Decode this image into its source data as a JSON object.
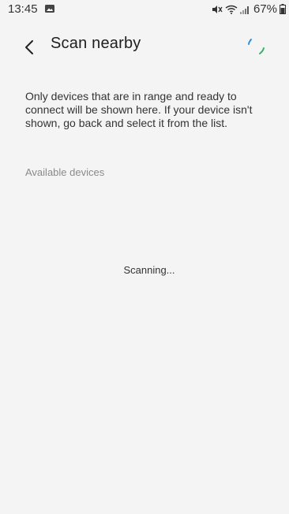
{
  "status_bar": {
    "time": "13:45",
    "battery": "67%",
    "icons": [
      "gallery-icon",
      "mute-icon",
      "wifi-icon",
      "signal-icon",
      "battery-icon"
    ]
  },
  "header": {
    "title": "Scan nearby",
    "back_icon": "chevron-left-icon",
    "spinner_icon": "loading-spinner-icon"
  },
  "main": {
    "description": "Only devices that are in range and ready to connect will be shown here. If your device isn't shown, go back and select it from the list.",
    "section_label": "Available devices",
    "status_text": "Scanning..."
  },
  "colors": {
    "background": "#f4f4f4",
    "text": "#202020",
    "secondary_text": "#8a8a8a",
    "spinner_blue": "#2f8fd8",
    "spinner_green": "#38b26a"
  }
}
